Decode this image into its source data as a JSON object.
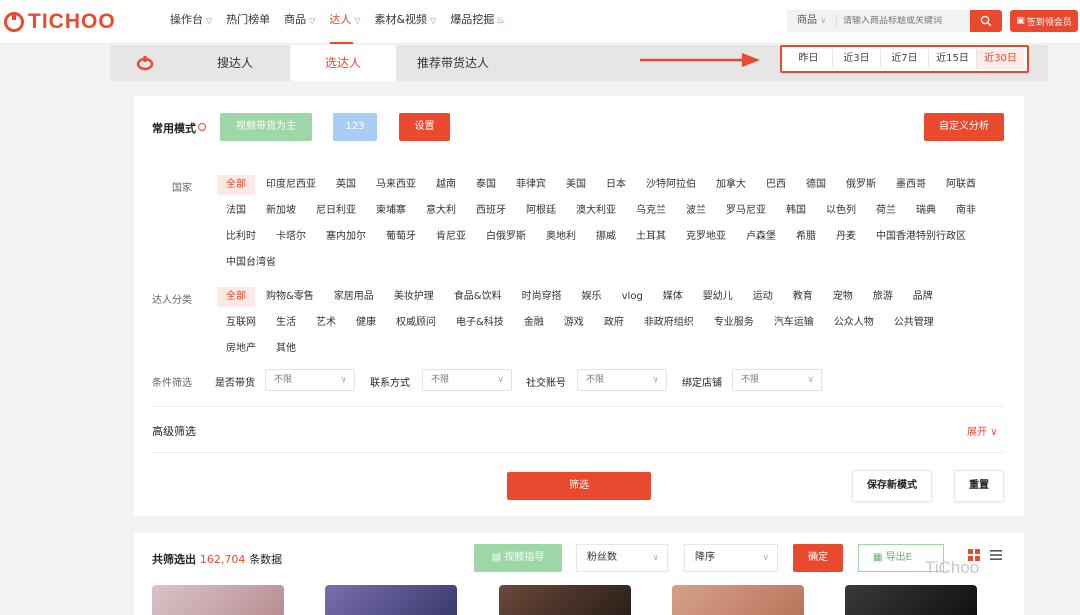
{
  "brand": {
    "name": "TICHOO",
    "accent": "#e94a2e"
  },
  "nav": {
    "items": [
      {
        "label": "操作台",
        "chevron": true,
        "active": false
      },
      {
        "label": "热门榜单",
        "chevron": false,
        "active": false
      },
      {
        "label": "商品",
        "chevron": true,
        "active": false
      },
      {
        "label": "达人",
        "chevron": true,
        "active": true
      },
      {
        "label": "素材&视频",
        "chevron": true,
        "active": false
      },
      {
        "label": "爆品挖掘",
        "chevron": false,
        "active": false,
        "icon": "fire-icon"
      }
    ],
    "search_category": "商品",
    "search_placeholder": "请输入商品标题或关键词",
    "signin_label": "签到领会员"
  },
  "tabs": [
    {
      "label": "搜达人"
    },
    {
      "label": "选达人",
      "active": true
    },
    {
      "label": "推荐带货达人"
    }
  ],
  "date_range": {
    "options": [
      "昨日",
      "近3日",
      "近7日",
      "近15日",
      "近30日"
    ],
    "selected": "近30日"
  },
  "modes": {
    "title": "常用模式",
    "preset1": "视频带货为主",
    "preset2": "123",
    "settings_label": "设置",
    "custom_analysis_label": "自定义分析"
  },
  "country_filter": {
    "label": "国家",
    "options": [
      "全部",
      "印度尼西亚",
      "英国",
      "马来西亚",
      "越南",
      "泰国",
      "菲律宾",
      "美国",
      "日本",
      "沙特阿拉伯",
      "加拿大",
      "巴西",
      "德国",
      "俄罗斯",
      "墨西哥",
      "阿联酋",
      "法国",
      "新加坡",
      "尼日利亚",
      "柬埔寨",
      "意大利",
      "西班牙",
      "阿根廷",
      "澳大利亚",
      "乌克兰",
      "波兰",
      "罗马尼亚",
      "韩国",
      "以色列",
      "荷兰",
      "瑞典",
      "南非",
      "比利时",
      "卡塔尔",
      "塞内加尔",
      "葡萄牙",
      "肯尼亚",
      "白俄罗斯",
      "奥地利",
      "挪威",
      "土耳其",
      "克罗地亚",
      "卢森堡",
      "希腊",
      "丹麦",
      "中国香港特别行政区",
      "中国台湾省"
    ]
  },
  "category_filter": {
    "label": "达人分类",
    "options": [
      "全部",
      "购物&零售",
      "家居用品",
      "美妆护理",
      "食品&饮料",
      "时尚穿搭",
      "娱乐",
      "vlog",
      "媒体",
      "婴幼儿",
      "运动",
      "教育",
      "宠物",
      "旅游",
      "品牌",
      "互联网",
      "生活",
      "艺术",
      "健康",
      "权威顾问",
      "电子&科技",
      "金融",
      "游戏",
      "政府",
      "非政府组织",
      "专业服务",
      "汽车运输",
      "公众人物",
      "公共管理",
      "房地产",
      "其他"
    ]
  },
  "conditions": {
    "label": "条件筛选",
    "fields": [
      {
        "label": "是否带货",
        "value": "不限"
      },
      {
        "label": "联系方式",
        "value": "不限"
      },
      {
        "label": "社交账号",
        "value": "不限"
      },
      {
        "label": "绑定店铺",
        "value": "不限"
      }
    ]
  },
  "advanced": {
    "title": "高级筛选",
    "expand_label": "展开"
  },
  "actions": {
    "filter_label": "筛选",
    "save_mode_label": "保存新模式",
    "reset_label": "重置"
  },
  "results": {
    "prefix": "共筛选出",
    "count": "162,704",
    "suffix": "条数据",
    "video_guide_label": "视频指导",
    "sort_field": "粉丝数",
    "sort_order": "降序",
    "confirm_label": "确定",
    "export_label": "导出E"
  },
  "watermark": "TiChoo"
}
